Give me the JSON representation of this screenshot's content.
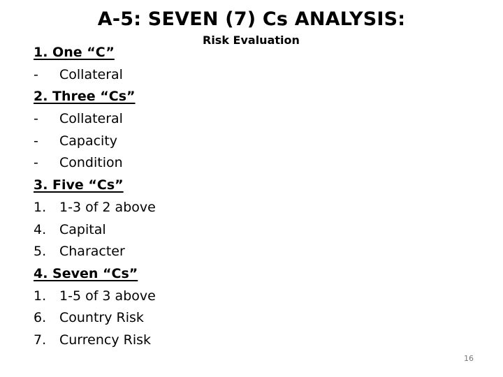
{
  "slide": {
    "title": "A-5: SEVEN (7) Cs ANALYSIS:",
    "subtitle": "Risk Evaluation",
    "page_number": "16"
  },
  "sections": [
    {
      "heading": "1. One “C”",
      "items": [
        {
          "marker": "-",
          "text": "Collateral"
        }
      ]
    },
    {
      "heading": "2. Three “Cs”",
      "items": [
        {
          "marker": "-",
          "text": "Collateral"
        },
        {
          "marker": "-",
          "text": "Capacity"
        },
        {
          "marker": "-",
          "text": "Condition"
        }
      ]
    },
    {
      "heading": "3. Five “Cs”",
      "items": [
        {
          "marker": "1.",
          "text": "1-3 of 2 above"
        },
        {
          "marker": "4.",
          "text": "Capital"
        },
        {
          "marker": "5.",
          "text": "Character"
        }
      ]
    },
    {
      "heading": "4. Seven “Cs”",
      "items": [
        {
          "marker": "1.",
          "text": "1-5 of 3 above"
        },
        {
          "marker": "6.",
          "text": "Country Risk"
        },
        {
          "marker": "7.",
          "text": "Currency Risk"
        }
      ]
    }
  ]
}
